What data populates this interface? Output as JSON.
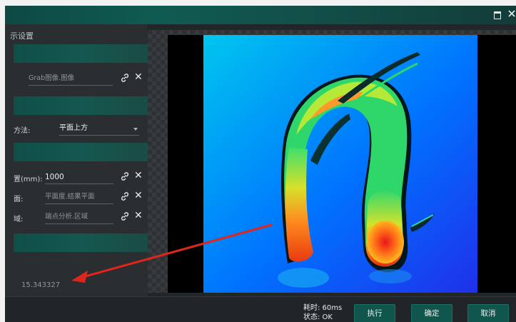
{
  "window": {
    "title_fragment": "示设置",
    "maximize_icon": "maximize-icon",
    "close_icon": "close-icon"
  },
  "panel": {
    "rows": {
      "grab": {
        "value": "Grab图像.图像"
      },
      "method": {
        "label": "方法:",
        "value": "平面上方"
      },
      "distance": {
        "label": "置(mm):",
        "value": "1000"
      },
      "plane": {
        "label": "面:",
        "value": "平面度.结果平面"
      },
      "region": {
        "label": "域:",
        "value": "端点分析.区域"
      }
    },
    "result_value": "15.343327"
  },
  "status": {
    "time": "耗时: 60ms",
    "state": "状态: OK"
  },
  "buttons": {
    "execute": "执行",
    "confirm": "确定",
    "cancel": "取消"
  },
  "colors": {
    "accent": "#10564c",
    "arrow": "#e0261c"
  }
}
